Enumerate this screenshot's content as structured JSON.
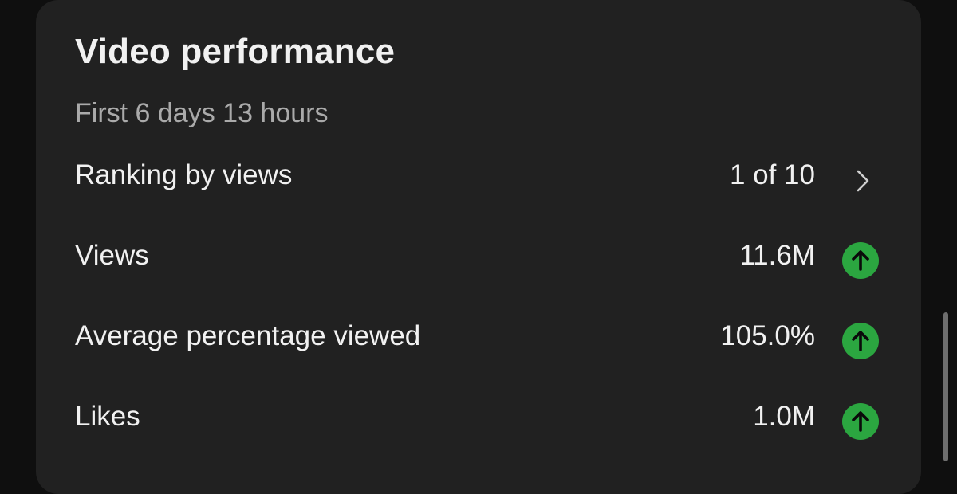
{
  "card": {
    "title": "Video performance",
    "subtitle": "First 6 days 13 hours"
  },
  "rows": [
    {
      "label": "Ranking by views",
      "value": "1 of 10",
      "icon": "chevron-right-icon"
    },
    {
      "label": "Views",
      "value": "11.6M",
      "icon": "arrow-up-icon"
    },
    {
      "label": "Average percentage viewed",
      "value": "105.0%",
      "icon": "arrow-up-icon"
    },
    {
      "label": "Likes",
      "value": "1.0M",
      "icon": "arrow-up-icon"
    }
  ],
  "colors": {
    "background": "#0f0f0f",
    "card": "#212121",
    "text": "#f1f1f1",
    "muted": "#aaaaaa",
    "positive": "#2ba640"
  }
}
